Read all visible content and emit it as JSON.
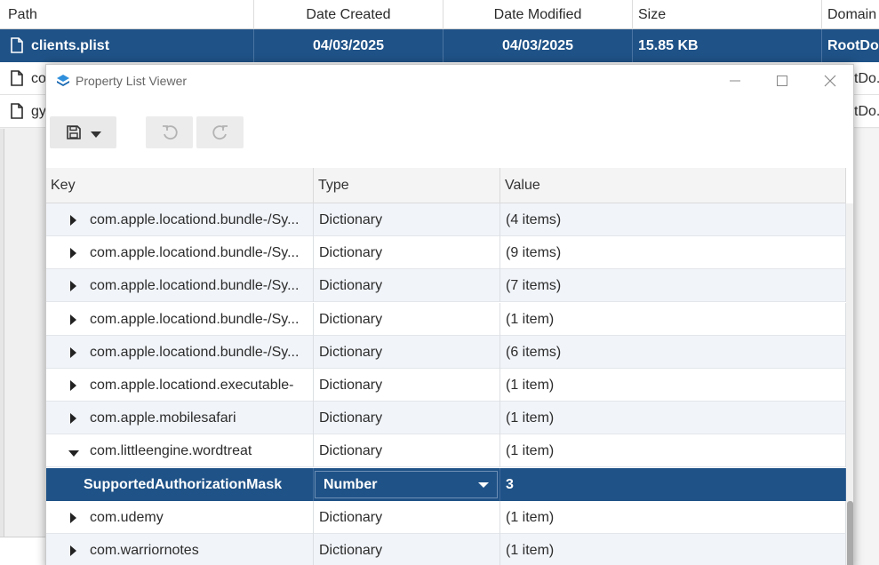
{
  "background_table": {
    "columns": [
      "Path",
      "Date Created",
      "Date Modified",
      "Size",
      "Domain"
    ],
    "rows": [
      {
        "path": "clients.plist",
        "created": "04/03/2025",
        "modified": "04/03/2025",
        "size": "15.85 KB",
        "domain": "RootDo..."
      },
      {
        "path": "co",
        "created": "",
        "modified": "",
        "size": "",
        "domain": "tDo..."
      },
      {
        "path": "gy",
        "created": "",
        "modified": "",
        "size": "",
        "domain": "tDo..."
      }
    ]
  },
  "dialog": {
    "title": "Property List Viewer",
    "toolbar": {
      "save_icon": "save-icon",
      "undo_icon": "undo-icon",
      "redo_icon": "redo-icon"
    },
    "columns": {
      "key": "Key",
      "type": "Type",
      "value": "Value"
    },
    "rows": [
      {
        "key": "com.apple.locationd.bundle-/Sy...",
        "type": "Dictionary",
        "value": "(4 items)",
        "expanded": false
      },
      {
        "key": "com.apple.locationd.bundle-/Sy...",
        "type": "Dictionary",
        "value": "(9 items)",
        "expanded": false
      },
      {
        "key": "com.apple.locationd.bundle-/Sy...",
        "type": "Dictionary",
        "value": "(7 items)",
        "expanded": false
      },
      {
        "key": "com.apple.locationd.bundle-/Sy...",
        "type": "Dictionary",
        "value": "(1 item)",
        "expanded": false
      },
      {
        "key": "com.apple.locationd.bundle-/Sy...",
        "type": "Dictionary",
        "value": "(6 items)",
        "expanded": false
      },
      {
        "key": "com.apple.locationd.executable-",
        "type": "Dictionary",
        "value": "(1 item)",
        "expanded": false
      },
      {
        "key": "com.apple.mobilesafari",
        "type": "Dictionary",
        "value": "(1 item)",
        "expanded": false
      },
      {
        "key": "com.littleengine.wordtreat",
        "type": "Dictionary",
        "value": "(1 item)",
        "expanded": true
      },
      {
        "key": "SupportedAuthorizationMask",
        "type": "Number",
        "value": "3",
        "child": true,
        "selected": true
      },
      {
        "key": "com.udemy",
        "type": "Dictionary",
        "value": "(1 item)",
        "expanded": false
      },
      {
        "key": "com.warriornotes",
        "type": "Dictionary",
        "value": "(1 item)",
        "expanded": false
      }
    ]
  },
  "colors": {
    "selection": "#1f5287",
    "row_alt": "#f1f4f9"
  }
}
